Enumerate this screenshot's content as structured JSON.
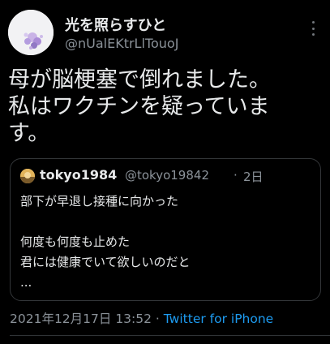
{
  "author": {
    "display_name": "光を照らすひと",
    "handle": "@nUalEKtrLlTouoJ"
  },
  "tweet": {
    "lines": [
      "母が脳梗塞で倒れました。",
      "私はワクチンを疑っていま",
      "す。"
    ]
  },
  "quote": {
    "display_name": "tokyo1984",
    "handle": "@tokyo19842",
    "separator": "·",
    "time": "2日",
    "lines": [
      "部下が早退し接種に向かった",
      "",
      "何度も何度も止めた",
      "君には健康でいて欲しいのだと",
      "..."
    ]
  },
  "meta": {
    "timestamp": "2021年12月17日 13:52",
    "separator": " · ",
    "source": "Twitter for iPhone"
  },
  "icons": {
    "more": "more-vertical-icon"
  },
  "colors": {
    "background": "#000000",
    "text": "#e7e9ea",
    "secondary": "#8b9299",
    "link": "#1d9bf0",
    "border": "#333639"
  }
}
